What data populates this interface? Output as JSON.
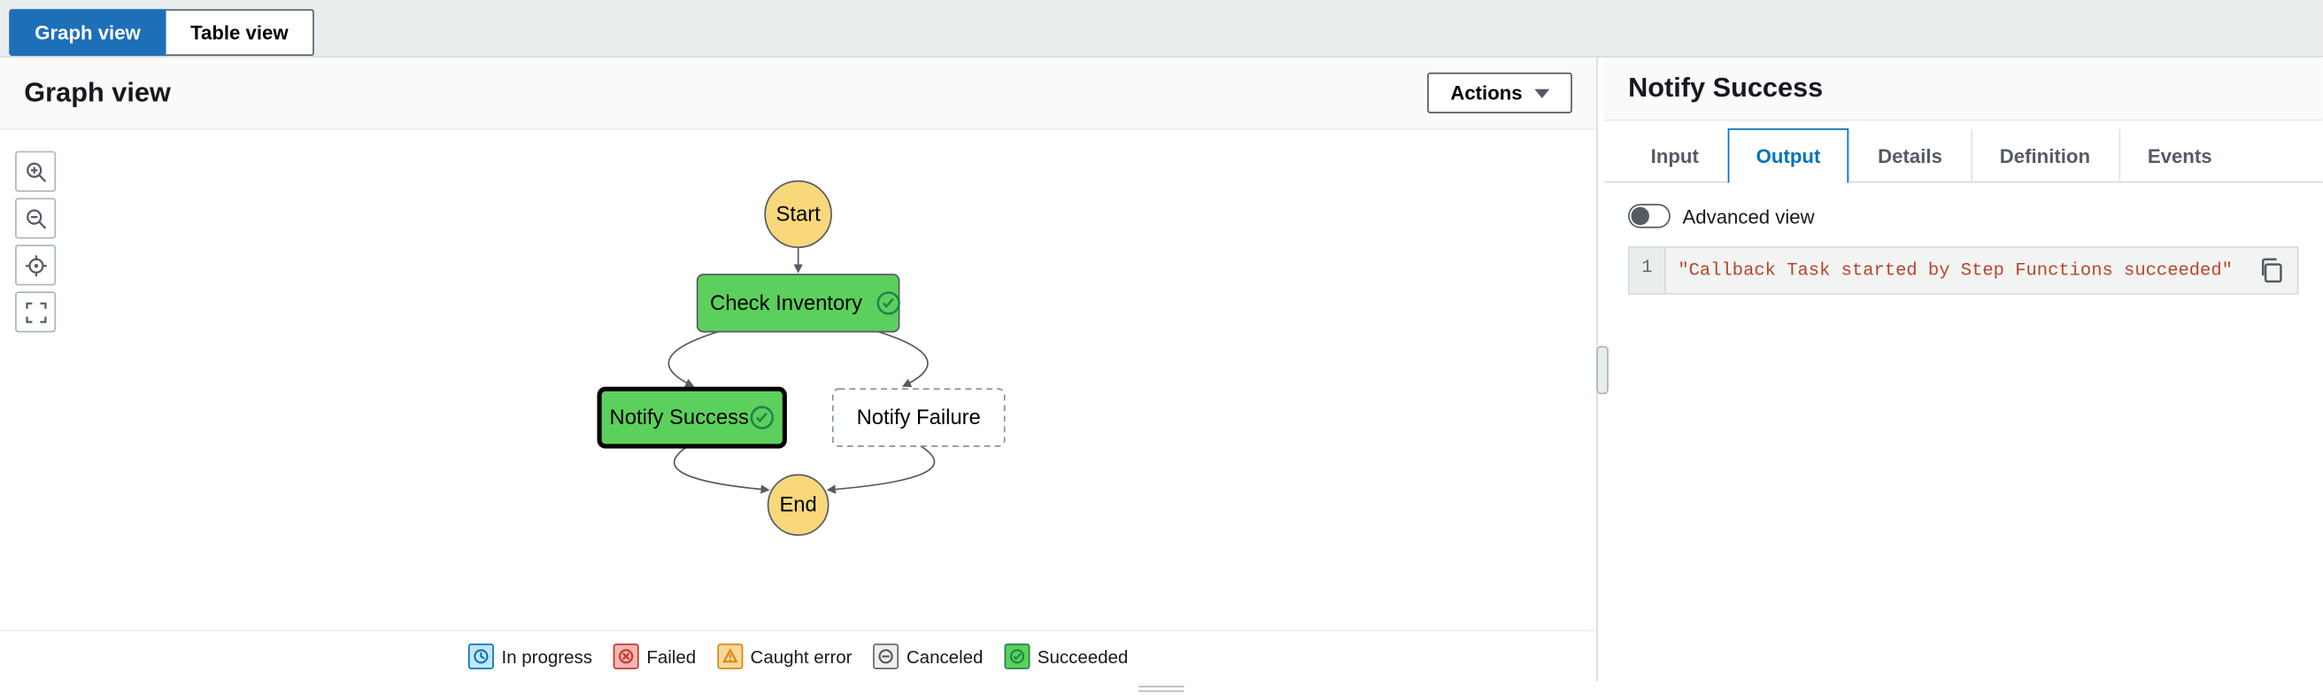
{
  "viewTabs": {
    "graph": "Graph view",
    "table": "Table view",
    "active": "graph"
  },
  "leftPanel": {
    "title": "Graph view",
    "actionsLabel": "Actions"
  },
  "graph": {
    "start": "Start",
    "checkInventory": "Check Inventory",
    "notifySuccess": "Notify Success",
    "notifyFailure": "Notify Failure",
    "end": "End",
    "selected": "notifySuccess"
  },
  "legend": {
    "inProgress": "In progress",
    "failed": "Failed",
    "caughtError": "Caught error",
    "canceled": "Canceled",
    "succeeded": "Succeeded"
  },
  "rightPanel": {
    "title": "Notify Success",
    "tabs": {
      "input": "Input",
      "output": "Output",
      "details": "Details",
      "definition": "Definition",
      "events": "Events",
      "active": "output"
    },
    "advancedViewLabel": "Advanced view",
    "advancedViewOn": false,
    "code": {
      "lineNo": "1",
      "content": "\"Callback Task started by Step Functions succeeded\""
    }
  }
}
